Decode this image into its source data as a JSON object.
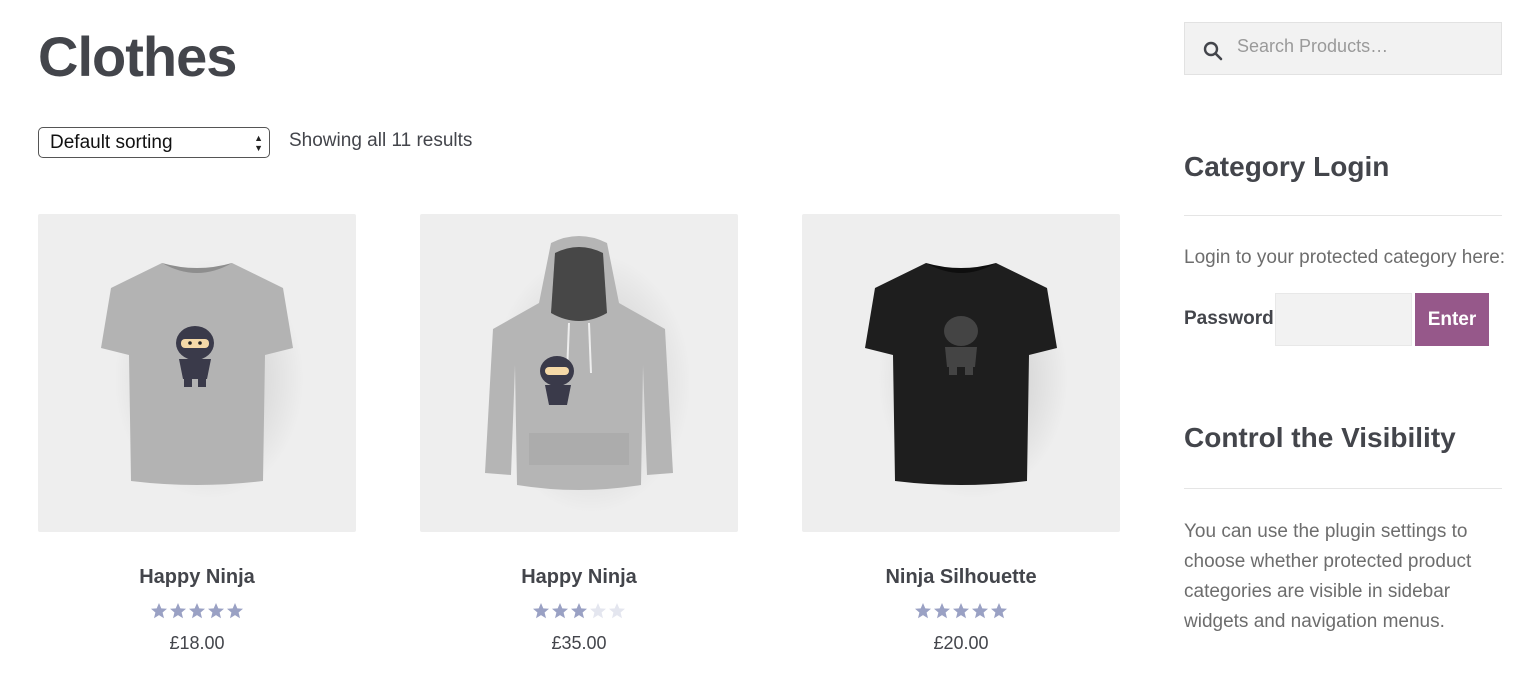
{
  "page": {
    "title": "Clothes"
  },
  "toolbar": {
    "sort_selected": "Default sorting",
    "result_count": "Showing all 11 results"
  },
  "products": [
    {
      "name": "Happy Ninja",
      "price": "£18.00",
      "rating": 5,
      "image": "grey-tshirt-ninja"
    },
    {
      "name": "Happy Ninja",
      "price": "£35.00",
      "rating": 3,
      "image": "grey-hoodie-ninja"
    },
    {
      "name": "Ninja Silhouette",
      "price": "£20.00",
      "rating": 5,
      "image": "black-tshirt-silhouette"
    }
  ],
  "sidebar": {
    "search": {
      "placeholder": "Search Products…"
    },
    "category_login": {
      "title": "Category Login",
      "description": "Login to your protected category here:",
      "password_label": "Password:",
      "button_label": "Enter"
    },
    "visibility": {
      "title": "Control the Visibility",
      "text": "You can use the plugin settings to choose whether protected product categories are visible in sidebar widgets and navigation menus."
    }
  },
  "colors": {
    "accent": "#96588a",
    "star_filled": "#9aa1c4",
    "star_empty": "#e4e6ef",
    "text": "#43454b"
  }
}
